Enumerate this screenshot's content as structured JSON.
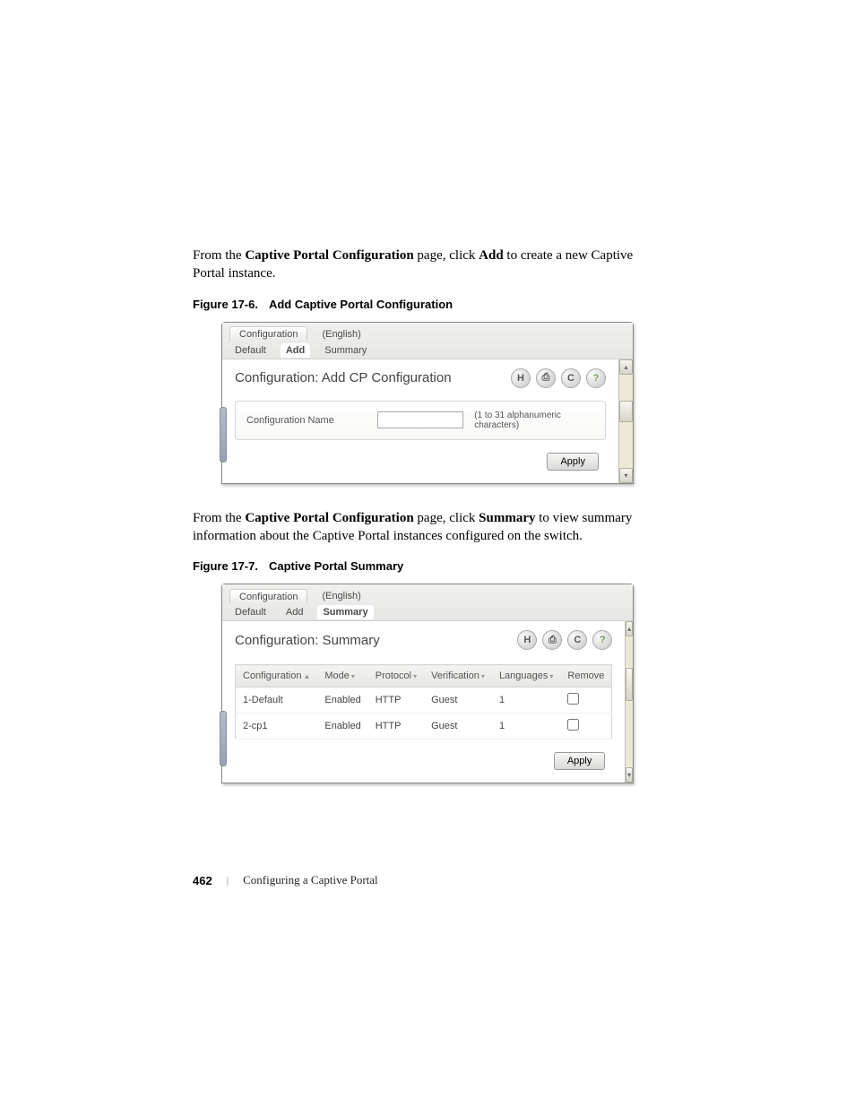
{
  "paragraphs": {
    "p1a": "From the ",
    "p1b": "Captive Portal Configuration",
    "p1c": " page, click ",
    "p1d": "Add",
    "p1e": " to create a new Captive Portal instance.",
    "p2a": "From the ",
    "p2b": "Captive Portal Configuration",
    "p2c": " page, click ",
    "p2d": "Summary",
    "p2e": " to view summary information about the Captive Portal instances configured on the switch."
  },
  "figures": {
    "f1num": "Figure 17-6.",
    "f1title": "Add Captive Portal Configuration",
    "f2num": "Figure 17-7.",
    "f2title": "Captive Portal Summary"
  },
  "screenshot1": {
    "top_tab1": "Configuration",
    "top_tab2": "(English)",
    "sub_tab1": "Default",
    "sub_tab2": "Add",
    "sub_tab3": "Summary",
    "panel_title": "Configuration: Add CP Configuration",
    "label": "Configuration Name",
    "hint": "(1 to 31 alphanumeric characters)",
    "apply": "Apply",
    "icons": {
      "save": "H",
      "print": "⎙",
      "refresh": "C",
      "help": "?"
    }
  },
  "screenshot2": {
    "top_tab1": "Configuration",
    "top_tab2": "(English)",
    "sub_tab1": "Default",
    "sub_tab2": "Add",
    "sub_tab3": "Summary",
    "panel_title": "Configuration: Summary",
    "apply": "Apply",
    "icons": {
      "save": "H",
      "print": "⎙",
      "refresh": "C",
      "help": "?"
    },
    "columns": {
      "c1": "Configuration",
      "c2": "Mode",
      "c3": "Protocol",
      "c4": "Verification",
      "c5": "Languages",
      "c6": "Remove"
    },
    "rows": [
      {
        "cfg": "1-Default",
        "mode": "Enabled",
        "proto": "HTTP",
        "verif": "Guest",
        "lang": "1"
      },
      {
        "cfg": "2-cp1",
        "mode": "Enabled",
        "proto": "HTTP",
        "verif": "Guest",
        "lang": "1"
      }
    ]
  },
  "footer": {
    "page": "462",
    "sep": "|",
    "chapter": "Configuring a Captive Portal"
  }
}
